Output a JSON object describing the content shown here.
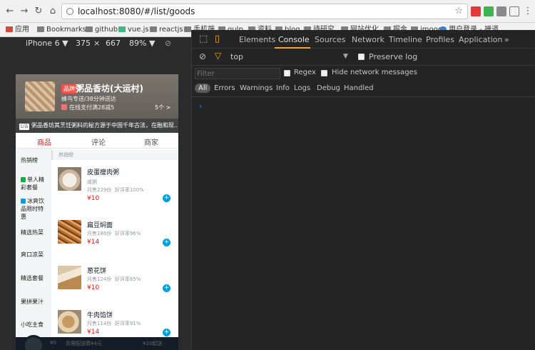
{
  "browser": {
    "url": "localhost:8080/#/list/goods",
    "bookmarks": [
      "应用",
      "Bookmarks",
      "github",
      "vue.js",
      "reactjs",
      "手机端",
      "gulp",
      "资料",
      "blog",
      "待研究",
      "网站优化",
      "掘金",
      "imooc",
      "用户登录 - 禅道"
    ]
  },
  "device": {
    "name": "iPhone 6 ▼",
    "width": "375",
    "times": "×",
    "height": "667",
    "zoom": "89% ▼"
  },
  "shop": {
    "badge": "品牌",
    "name": "粥品香坊(大运村)",
    "delivery": "蜂鸟专送/38分钟送达",
    "promo": "在线支付满28减5",
    "promo_count": "5个 >",
    "bulletin_tag": "公告",
    "bulletin": "粥品香坊其烹饪粥料的秘方源于中国千年古法，在融和现...  >"
  },
  "tabs": [
    "商品",
    "评论",
    "商家"
  ],
  "menu": [
    {
      "label": "热销榜",
      "icon": ""
    },
    {
      "label": "单人精彩套餐",
      "icon": "#00b43c"
    },
    {
      "label": "冰爽饮品限时特惠",
      "icon": "#00a0dc"
    },
    {
      "label": "精选热菜",
      "icon": ""
    },
    {
      "label": "爽口凉菜",
      "icon": ""
    },
    {
      "label": "精选套餐",
      "icon": ""
    },
    {
      "label": "果拼果汁",
      "icon": ""
    },
    {
      "label": "小吃主食",
      "icon": ""
    }
  ],
  "food_section": "热销榜",
  "foods": [
    {
      "name": "皮蛋瘦肉粥",
      "desc": "咸粥",
      "sales": "月售229份",
      "rating": "好评率100%",
      "price": "¥10"
    },
    {
      "name": "扁豆焖面",
      "desc": "",
      "sales": "月售188份",
      "rating": "好评率96%",
      "price": "¥14"
    },
    {
      "name": "葱花饼",
      "desc": "",
      "sales": "月售124份",
      "rating": "好评率85%",
      "price": "¥10"
    },
    {
      "name": "牛肉馅饼",
      "desc": "",
      "sales": "月售114份",
      "rating": "好评率91%",
      "price": "¥14"
    }
  ],
  "shopcart": {
    "price": "¥0",
    "delivery": "另需配送费¥4元",
    "pay": "¥20起送"
  },
  "devtools": {
    "tabs": [
      "Elements",
      "Console",
      "Sources",
      "Network",
      "Timeline",
      "Profiles",
      "Application",
      "»"
    ],
    "context": "top",
    "preserve_log": "Preserve log",
    "filter_placeholder": "Filter",
    "regex": "Regex",
    "hide_network": "Hide network messages",
    "levels": [
      "All",
      "Errors",
      "Warnings",
      "Info",
      "Logs",
      "Debug",
      "Handled"
    ],
    "prompt": "›"
  },
  "colors": {
    "accent_red": "#f01414",
    "devtools_bg": "#242424",
    "console_active": "#f0a52d",
    "add_blue": "#00a0dc"
  }
}
